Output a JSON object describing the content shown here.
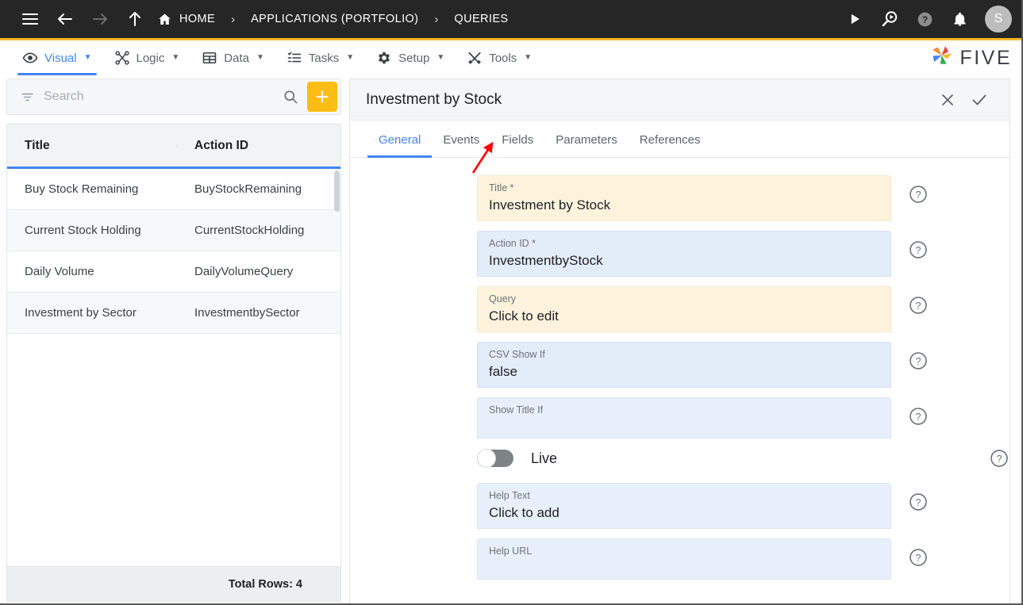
{
  "topbar": {
    "menu_icon": "hamburger-icon",
    "back_icon": "arrow-left-icon",
    "forward_icon": "arrow-right-icon",
    "up_icon": "arrow-up-icon",
    "breadcrumbs": [
      {
        "label": "HOME",
        "icon": "home-icon"
      },
      {
        "label": "APPLICATIONS (PORTFOLIO)",
        "icon": ""
      },
      {
        "label": "QUERIES",
        "icon": ""
      }
    ],
    "separator": "›",
    "actions": [
      {
        "name": "run-icon",
        "title": "Run"
      },
      {
        "name": "search-play-icon",
        "title": "Search"
      },
      {
        "name": "help-circle-icon",
        "title": "Help"
      },
      {
        "name": "bell-icon",
        "title": "Notifications"
      }
    ],
    "avatar_initial": "S",
    "accent_color": "#f5b825",
    "bg_color": "#262626"
  },
  "menubar": {
    "items": [
      {
        "label": "Visual",
        "icon": "eye-icon",
        "active": true
      },
      {
        "label": "Logic",
        "icon": "logic-nodes-icon",
        "active": false
      },
      {
        "label": "Data",
        "icon": "table-grid-icon",
        "active": false
      },
      {
        "label": "Tasks",
        "icon": "task-list-icon",
        "active": false
      },
      {
        "label": "Setup",
        "icon": "gear-icon",
        "active": false
      },
      {
        "label": "Tools",
        "icon": "tools-cross-icon",
        "active": false
      }
    ],
    "caret": "▼",
    "brand": "FIVE",
    "active_color": "#4285f4"
  },
  "sidebar": {
    "search": {
      "placeholder": "Search",
      "value": "",
      "filter_icon": "filter-icon",
      "search_icon": "search-icon"
    },
    "add_button": {
      "label": "+",
      "color": "#fbbc14"
    },
    "columns": [
      "Title",
      "Action ID"
    ],
    "rows": [
      {
        "title": "Buy Stock Remaining",
        "action_id": "BuyStockRemaining"
      },
      {
        "title": "Current Stock Holding",
        "action_id": "CurrentStockHolding"
      },
      {
        "title": "Daily Volume",
        "action_id": "DailyVolumeQuery"
      },
      {
        "title": "Investment by Sector",
        "action_id": "InvestmentbySector"
      }
    ],
    "footer": {
      "total_rows": "Total Rows: 4"
    }
  },
  "panel": {
    "title": "Investment by Stock",
    "close_icon": "close-icon",
    "confirm_icon": "check-icon",
    "tabs": [
      {
        "label": "General",
        "active": true
      },
      {
        "label": "Events",
        "active": false
      },
      {
        "label": "Fields",
        "active": false
      },
      {
        "label": "Parameters",
        "active": false
      },
      {
        "label": "References",
        "active": false
      }
    ],
    "fields": [
      {
        "label": "Title *",
        "value": "Investment by Stock",
        "style": "cream"
      },
      {
        "label": "Action ID *",
        "value": "InvestmentbyStock",
        "style": "blue"
      },
      {
        "label": "Query",
        "value": "Click to edit",
        "style": "cream"
      },
      {
        "label": "CSV Show If",
        "value": "false",
        "style": "blue"
      },
      {
        "label": "Show Title If",
        "value": "",
        "style": "blue-pale"
      }
    ],
    "toggle": {
      "label": "Live",
      "on": false
    },
    "fields_after_toggle": [
      {
        "label": "Help Text",
        "value": "Click to add",
        "style": "blue-pale"
      },
      {
        "label": "Help URL",
        "value": "",
        "style": "blue-pale"
      }
    ],
    "help_icon": "question-circle-icon"
  },
  "annotation": {
    "type": "arrow",
    "color": "#ff0000",
    "points_to": "Fields"
  }
}
